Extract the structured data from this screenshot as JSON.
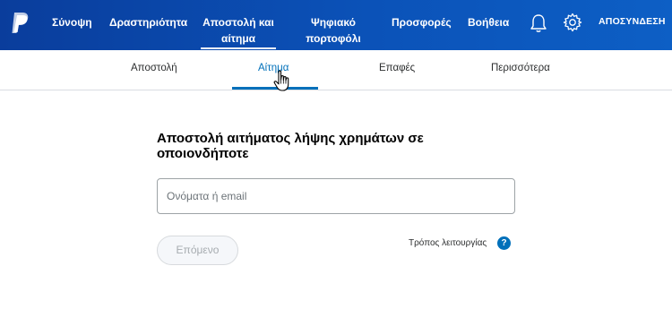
{
  "colors": {
    "topbar_start": "#0a3d9c",
    "topbar_end": "#0d5fc5",
    "accent": "#0070ba",
    "disabled_text": "#a7acb0"
  },
  "topnav": {
    "logo_icon": "paypal-logo",
    "items": [
      {
        "label": "Σύνοψη"
      },
      {
        "label": "Δραστηριότητα"
      },
      {
        "label": "Αποστολή και αίτημα",
        "active": true
      },
      {
        "label": "Ψηφιακό πορτοφόλι"
      },
      {
        "label": "Προσφορές"
      },
      {
        "label": "Βοήθεια"
      }
    ],
    "notifications_icon": "bell-icon",
    "settings_icon": "gear-icon",
    "logout_label": "ΑΠΟΣΥΝΔΕΣΗ"
  },
  "subnav": {
    "items": [
      {
        "label": "Αποστολή"
      },
      {
        "label": "Αίτημα",
        "active": true
      },
      {
        "label": "Επαφές"
      },
      {
        "label": "Περισσότερα"
      }
    ]
  },
  "main": {
    "heading": "Αποστολή αιτήματος λήψης χρημάτων σε οποιονδήποτε",
    "recipient_placeholder": "Ονόματα ή email",
    "recipient_value": "",
    "next_label": "Επόμενο",
    "how_it_works_label": "Τρόπος λειτουργίας",
    "help_icon_glyph": "?"
  }
}
